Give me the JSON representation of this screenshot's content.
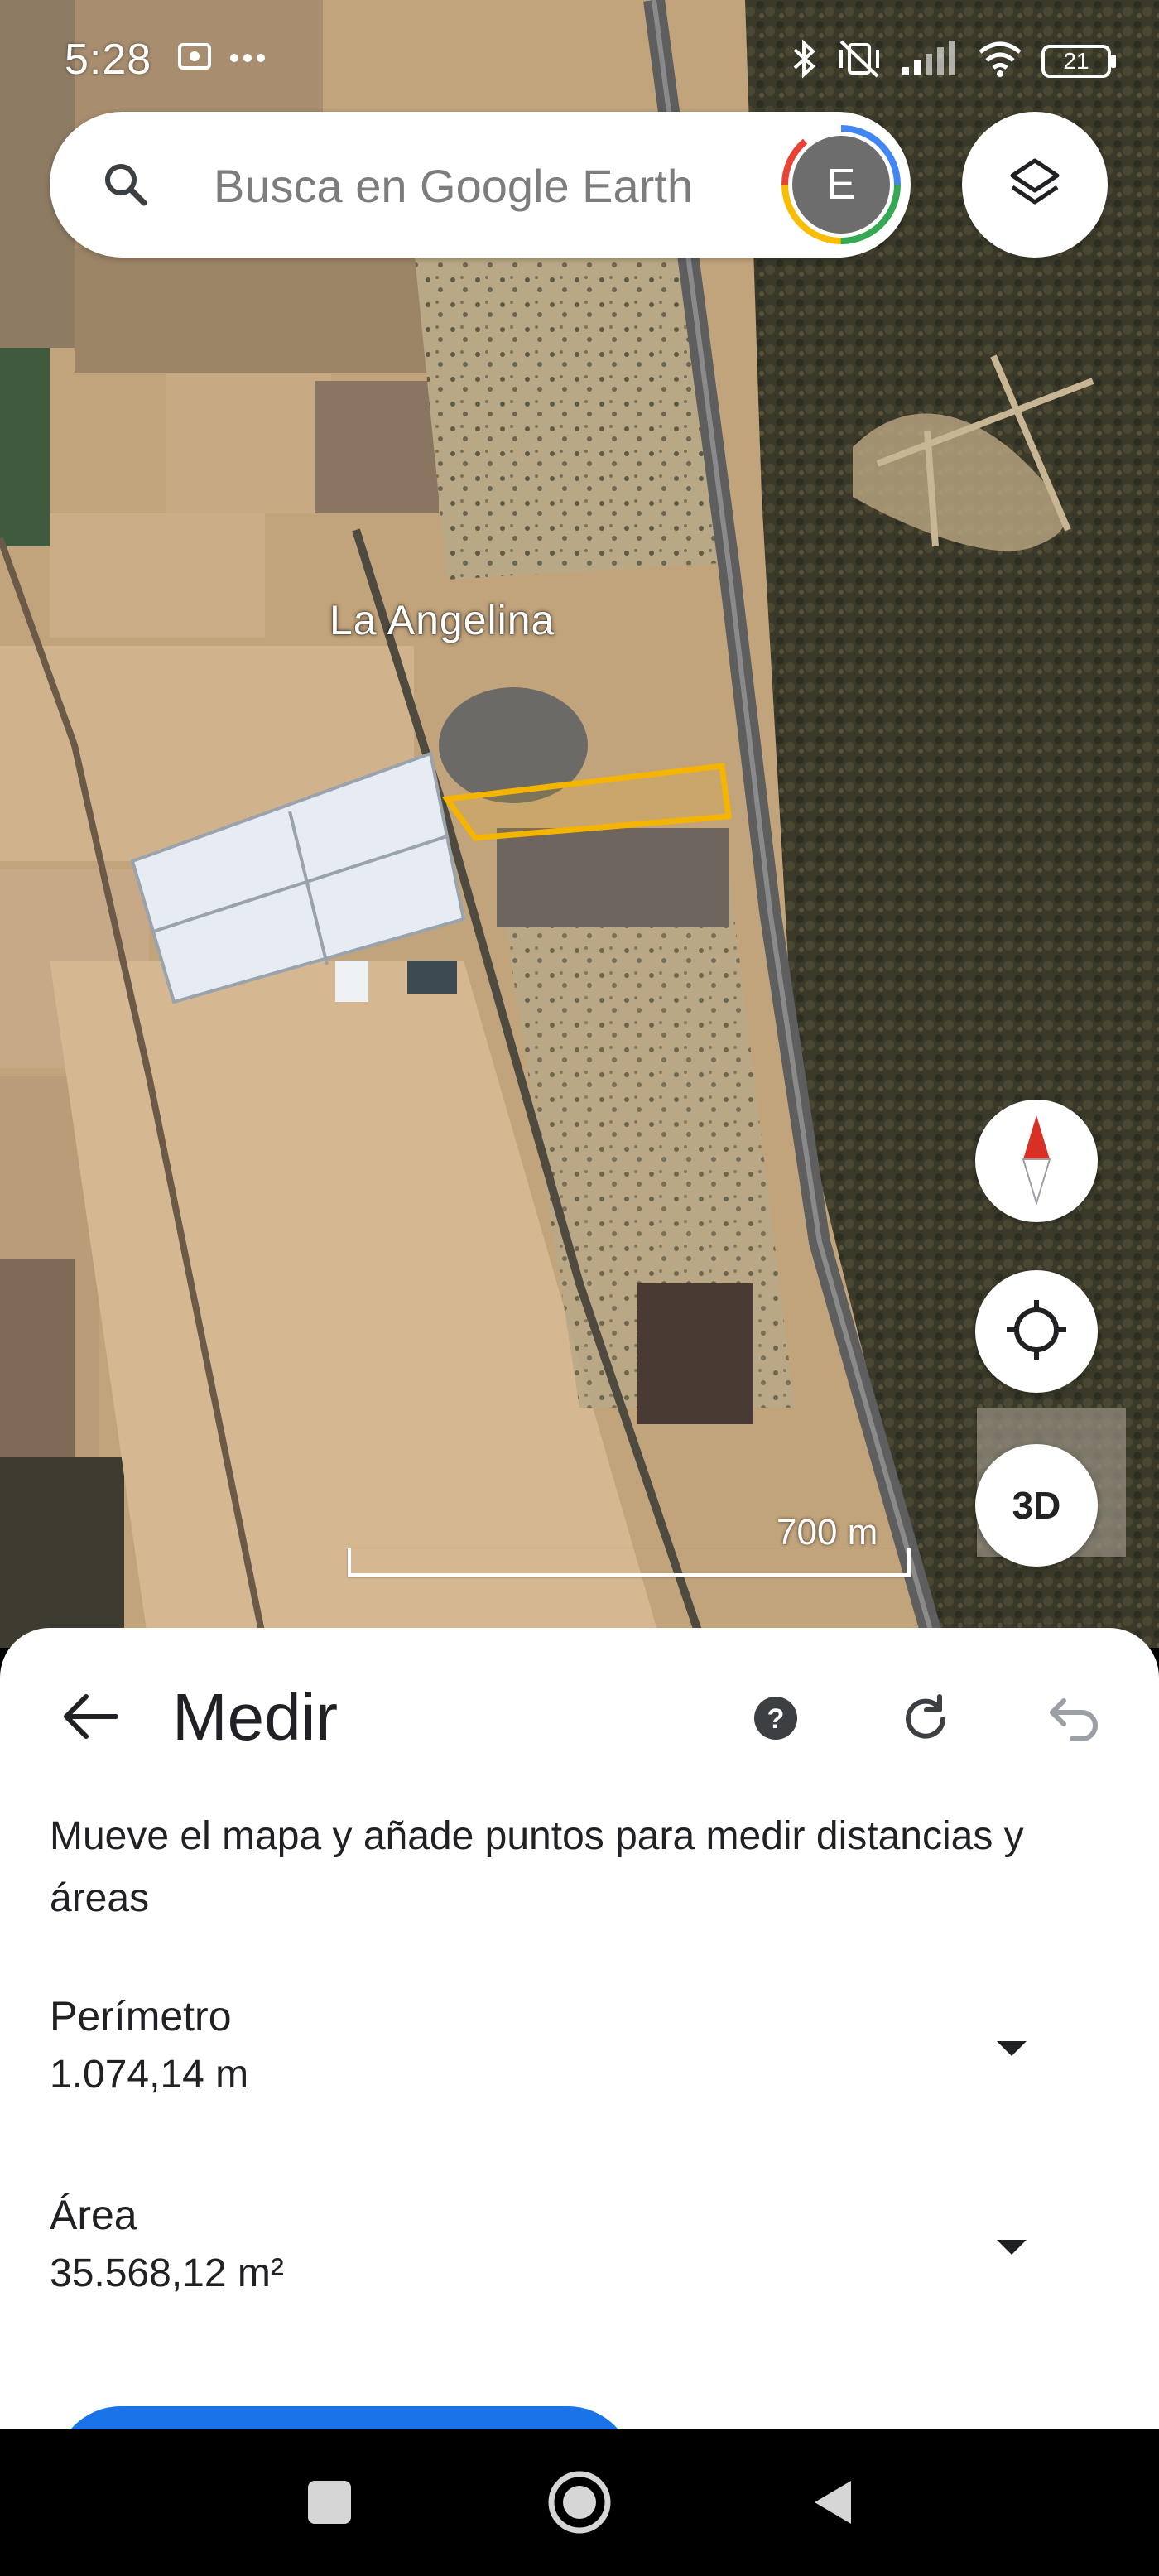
{
  "status_bar": {
    "time": "5:28",
    "battery": "21",
    "icons": [
      "whatsapp-notification-icon",
      "more-icon",
      "bluetooth-icon",
      "vibrate-off-icon",
      "signal-icon",
      "wifi-icon",
      "battery-icon"
    ]
  },
  "search": {
    "placeholder": "Busca en Google Earth",
    "avatar_initial": "E"
  },
  "map": {
    "place_label": "La Angelina",
    "scale_label": "700 m",
    "three_d_label": "3D",
    "colors": {
      "measure_polygon": "#f4b400",
      "compass_red": "#d93025"
    }
  },
  "sheet": {
    "title": "Medir",
    "instructions": "Mueve el mapa y añade puntos para medir distancias y áreas",
    "measurements": [
      {
        "label": "Perímetro",
        "value": "1.074,14 m"
      },
      {
        "label": "Área",
        "value": "35.568,12 m²"
      }
    ],
    "primary_color": "#1a73e8"
  }
}
